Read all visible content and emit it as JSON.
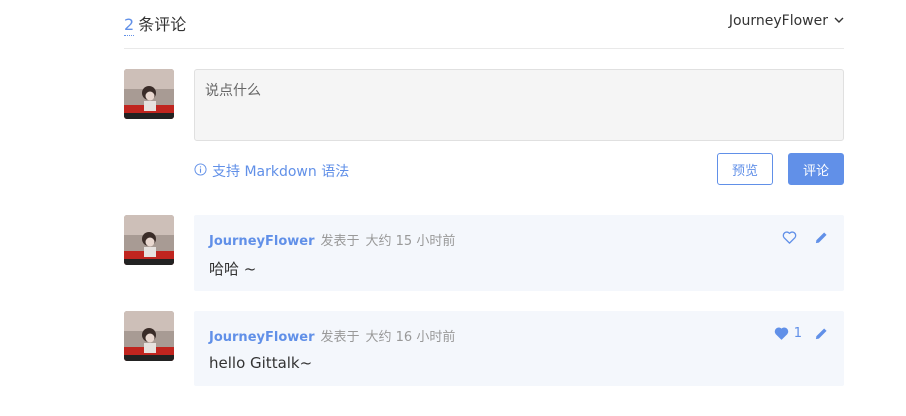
{
  "header": {
    "comment_count": "2",
    "count_label": "条评论",
    "user_menu_name": "JourneyFlower"
  },
  "editor": {
    "placeholder": "说点什么",
    "markdown_tip": "支持 Markdown 语法",
    "preview_label": "预览",
    "submit_label": "评论"
  },
  "comments": [
    {
      "user": "JourneyFlower",
      "verb": "发表于",
      "time": "大约 15 小时前",
      "body": "哈哈 ~",
      "likes": "",
      "liked": false
    },
    {
      "user": "JourneyFlower",
      "verb": "发表于",
      "time": "大约 16 小时前",
      "body": "hello Gittalk~",
      "likes": "1",
      "liked": true
    }
  ],
  "colors": {
    "accent": "#6190e8",
    "comment_bg": "#f4f7fc",
    "editor_bg": "#f5f5f5"
  },
  "icons": [
    "chevron-down-icon",
    "info-icon",
    "heart-outline-icon",
    "heart-filled-icon",
    "pencil-icon"
  ]
}
